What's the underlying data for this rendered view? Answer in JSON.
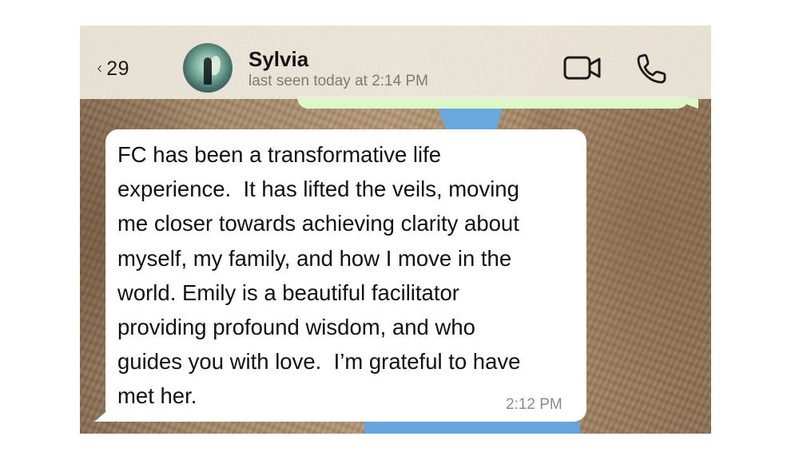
{
  "header": {
    "back_count": "29",
    "contact_name": "Sylvia",
    "last_seen": "last seen today at 2:14 PM",
    "icons": {
      "back": "chevron-left-icon",
      "avatar": "contact-avatar",
      "video": "video-call-icon",
      "phone": "voice-call-icon"
    }
  },
  "message": {
    "lines": [
      "FC has been a transformative life",
      "experience.  It has lifted the veils, moving",
      "me closer towards achieving clarity about",
      "myself, my family, and how I move in the",
      "world. Emily is a beautiful facilitator",
      "providing profound wisdom, and who",
      "guides you with love.  I’m grateful to have",
      "met her."
    ],
    "time": "2:12 PM",
    "direction": "incoming"
  },
  "colors": {
    "header_bg": "#eee9de",
    "incoming_bubble": "#ffffff",
    "outgoing_bubble": "#dcf8c6",
    "timestamp": "#8a8a8a"
  }
}
